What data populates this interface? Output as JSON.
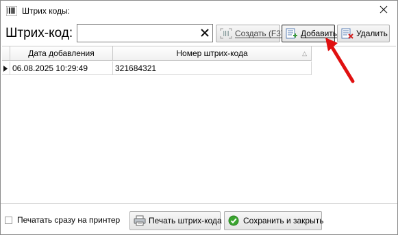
{
  "window": {
    "title": "Штрих коды:"
  },
  "barcode": {
    "label": "Штрих-код:",
    "value": "",
    "clear_glyph": "✕"
  },
  "toolbar": {
    "create_label": "Создать (F3)",
    "add_label": "Добавить",
    "delete_label": "Удалить"
  },
  "table": {
    "columns": [
      "Дата добавления",
      "Номер штрих-кода"
    ],
    "sort_indicator": "△",
    "rows": [
      {
        "date": "06.08.2025 10:29:49",
        "number": "321684321"
      }
    ]
  },
  "footer": {
    "print_immediately_label": "Печатать сразу на принтер",
    "print_immediately_checked": false,
    "print_barcode_label": "Печать штрих-кода",
    "save_close_label": "Сохранить и закрыть"
  },
  "icons": {
    "window": "barcode-icon",
    "create": "barcode-scan-icon",
    "add": "add-document-icon",
    "delete": "delete-document-icon",
    "print": "printer-icon",
    "save": "green-check-icon"
  },
  "colors": {
    "annotation_arrow": "#e01010",
    "check_green": "#3aa52f"
  }
}
